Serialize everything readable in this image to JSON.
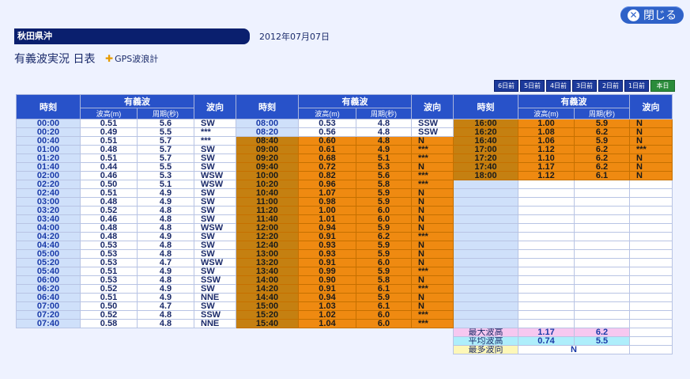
{
  "close_label": "閉じる",
  "region": "秋田県沖",
  "date": "2012年07月07日",
  "title": "有義波実況 日表",
  "gps_label": "GPS波浪計",
  "nav": [
    "6日前",
    "5日前",
    "4日前",
    "3日前",
    "2日前",
    "1日前",
    "本日"
  ],
  "headers": {
    "time": "時刻",
    "sig_wave": "有義波",
    "direction": "波向",
    "height": "波高(m)",
    "period": "周期(秒)"
  },
  "col1": [
    [
      "00:00",
      "0.51",
      "5.6",
      "SW"
    ],
    [
      "00:20",
      "0.49",
      "5.5",
      "***"
    ],
    [
      "00:40",
      "0.51",
      "5.7",
      "***"
    ],
    [
      "01:00",
      "0.48",
      "5.7",
      "SW"
    ],
    [
      "01:20",
      "0.51",
      "5.7",
      "SW"
    ],
    [
      "01:40",
      "0.44",
      "5.5",
      "SW"
    ],
    [
      "02:00",
      "0.46",
      "5.3",
      "WSW"
    ],
    [
      "02:20",
      "0.50",
      "5.1",
      "WSW"
    ],
    [
      "02:40",
      "0.51",
      "4.9",
      "SW"
    ],
    [
      "03:00",
      "0.48",
      "4.9",
      "SW"
    ],
    [
      "03:20",
      "0.52",
      "4.8",
      "SW"
    ],
    [
      "03:40",
      "0.46",
      "4.8",
      "SW"
    ],
    [
      "04:00",
      "0.48",
      "4.8",
      "WSW"
    ],
    [
      "04:20",
      "0.48",
      "4.9",
      "SW"
    ],
    [
      "04:40",
      "0.53",
      "4.8",
      "SW"
    ],
    [
      "05:00",
      "0.53",
      "4.8",
      "SW"
    ],
    [
      "05:20",
      "0.53",
      "4.7",
      "WSW"
    ],
    [
      "05:40",
      "0.51",
      "4.9",
      "SW"
    ],
    [
      "06:00",
      "0.53",
      "4.8",
      "SSW"
    ],
    [
      "06:20",
      "0.52",
      "4.9",
      "SW"
    ],
    [
      "06:40",
      "0.51",
      "4.9",
      "NNE"
    ],
    [
      "07:00",
      "0.50",
      "4.7",
      "SW"
    ],
    [
      "07:20",
      "0.52",
      "4.8",
      "SSW"
    ],
    [
      "07:40",
      "0.58",
      "4.8",
      "NNE"
    ]
  ],
  "col2": [
    [
      "08:00",
      "0.53",
      "4.8",
      "SSW"
    ],
    [
      "08:20",
      "0.56",
      "4.8",
      "SSW"
    ],
    [
      "08:40",
      "0.60",
      "4.8",
      "N"
    ],
    [
      "09:00",
      "0.61",
      "4.9",
      "***"
    ],
    [
      "09:20",
      "0.68",
      "5.1",
      "***"
    ],
    [
      "09:40",
      "0.72",
      "5.3",
      "N"
    ],
    [
      "10:00",
      "0.82",
      "5.6",
      "***"
    ],
    [
      "10:20",
      "0.96",
      "5.8",
      "***"
    ],
    [
      "10:40",
      "1.07",
      "5.9",
      "N"
    ],
    [
      "11:00",
      "0.98",
      "5.9",
      "N"
    ],
    [
      "11:20",
      "1.00",
      "6.0",
      "N"
    ],
    [
      "11:40",
      "1.01",
      "6.0",
      "N"
    ],
    [
      "12:00",
      "0.94",
      "5.9",
      "N"
    ],
    [
      "12:20",
      "0.91",
      "6.2",
      "***"
    ],
    [
      "12:40",
      "0.93",
      "5.9",
      "N"
    ],
    [
      "13:00",
      "0.93",
      "5.9",
      "N"
    ],
    [
      "13:20",
      "0.91",
      "6.0",
      "N"
    ],
    [
      "13:40",
      "0.99",
      "5.9",
      "***"
    ],
    [
      "14:00",
      "0.90",
      "5.8",
      "N"
    ],
    [
      "14:20",
      "0.91",
      "6.1",
      "***"
    ],
    [
      "14:40",
      "0.94",
      "5.9",
      "N"
    ],
    [
      "15:00",
      "1.03",
      "6.1",
      "N"
    ],
    [
      "15:20",
      "1.02",
      "6.0",
      "***"
    ],
    [
      "15:40",
      "1.04",
      "6.0",
      "***"
    ]
  ],
  "col3": [
    [
      "16:00",
      "1.00",
      "5.9",
      "N"
    ],
    [
      "16:20",
      "1.08",
      "6.2",
      "N"
    ],
    [
      "16:40",
      "1.06",
      "5.9",
      "N"
    ],
    [
      "17:00",
      "1.12",
      "6.2",
      "***"
    ],
    [
      "17:20",
      "1.10",
      "6.2",
      "N"
    ],
    [
      "17:40",
      "1.17",
      "6.2",
      "N"
    ],
    [
      "18:00",
      "1.12",
      "6.1",
      "N"
    ]
  ],
  "stats": {
    "max_label": "最大波高",
    "max_height": "1.17",
    "max_period": "6.2",
    "avg_label": "平均波高",
    "avg_height": "0.74",
    "avg_period": "5.5",
    "dir_label": "最多波向",
    "dir_value": "N"
  },
  "colors": {
    "header_blue": "#2852c9",
    "time_cell": "#cfe0fa",
    "highlight_orange": "#ef8a11",
    "active_tab": "#2a8b3a"
  }
}
